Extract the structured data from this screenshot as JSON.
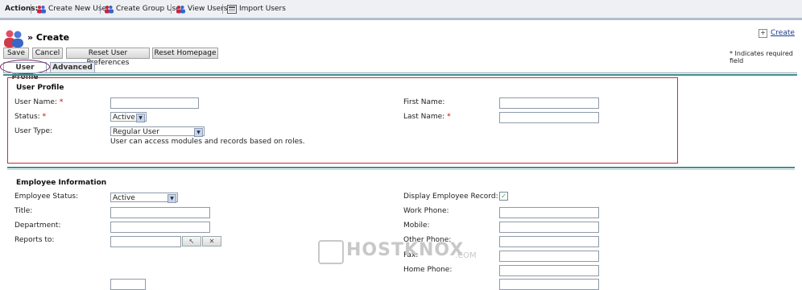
{
  "actions": {
    "label": "Actions:",
    "items": [
      {
        "label": "Create New User",
        "icon": "users-icon"
      },
      {
        "label": "Create Group User",
        "icon": "users-icon"
      },
      {
        "label": "View Users",
        "icon": "users-icon"
      },
      {
        "label": "Import Users",
        "icon": "import-icon"
      }
    ]
  },
  "header": {
    "title": "» Create",
    "create_link": "Create",
    "required_note": "* Indicates required field"
  },
  "toolbar": {
    "save": "Save",
    "cancel": "Cancel",
    "reset_prefs": "Reset User Preferences",
    "reset_home": "Reset Homepage"
  },
  "tabs": {
    "profile": "User Profile",
    "advanced": "Advanced"
  },
  "user_profile": {
    "title": "User Profile",
    "user_name_label": "User Name:",
    "status_label": "Status:",
    "status_value": "Active",
    "user_type_label": "User Type:",
    "user_type_value": "Regular User",
    "user_type_help": "User can access modules and records based on roles.",
    "first_name_label": "First Name:",
    "last_name_label": "Last Name:",
    "required_mark": "*"
  },
  "employee": {
    "title": "Employee Information",
    "employee_status_label": "Employee Status:",
    "employee_status_value": "Active",
    "title_label": "Title:",
    "department_label": "Department:",
    "reports_to_label": "Reports to:",
    "display_record_label": "Display Employee Record:",
    "display_record_checked": true,
    "work_phone_label": "Work Phone:",
    "mobile_label": "Mobile:",
    "other_phone_label": "Other Phone:",
    "fax_label": "Fax:",
    "home_phone_label": "Home Phone:",
    "check_glyph": "✓",
    "select_glyph": "↖",
    "clear_glyph": "✕"
  },
  "watermark": {
    "text": "HOSTKNOX",
    "suffix": ".COM"
  }
}
